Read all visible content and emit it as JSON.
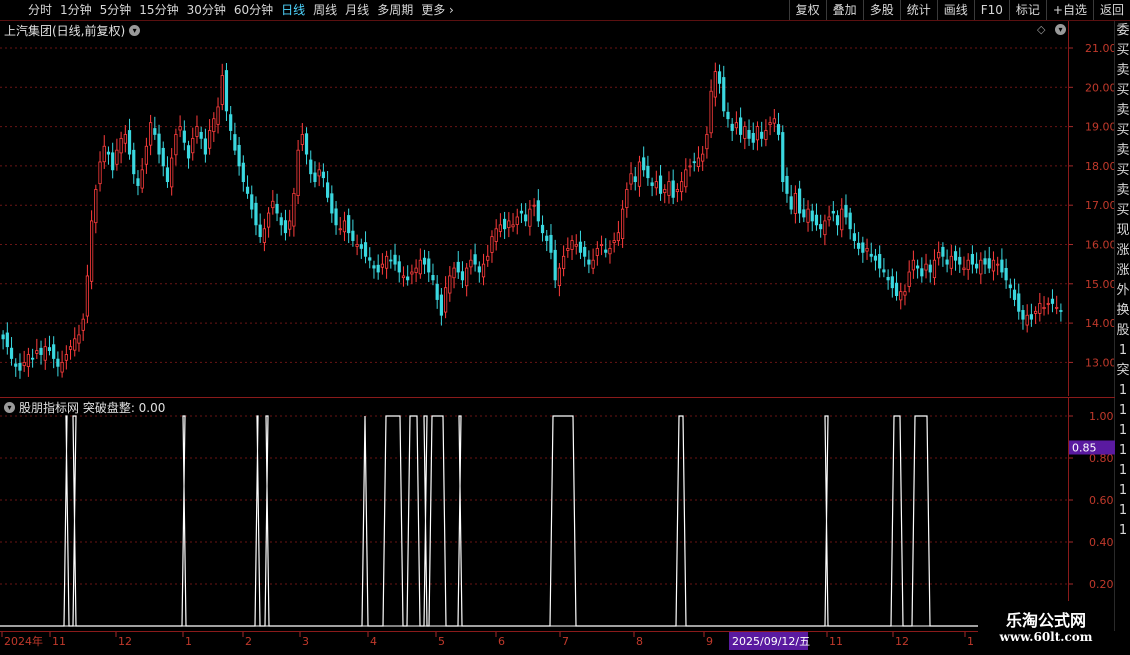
{
  "toolbar": {
    "periods": [
      "分时",
      "1分钟",
      "5分钟",
      "15分钟",
      "30分钟",
      "60分钟",
      "日线",
      "周线",
      "月线",
      "多周期",
      "更多 ›"
    ],
    "active": "日线",
    "right_buttons": [
      "复权",
      "叠加",
      "多股",
      "统计",
      "画线",
      "F10",
      "标记",
      "+自选",
      "返回"
    ]
  },
  "main_title": "上汽集团(日线,前复权)",
  "sub_title": "股朋指标网 突破盘整: 0.00",
  "side_strip_chars": [
    "委",
    "买",
    "卖",
    "买",
    "卖",
    "买",
    "卖",
    "买",
    "卖",
    "买",
    "现",
    "涨",
    "涨",
    "外",
    "换",
    "股",
    "1",
    "突",
    "1",
    "1",
    "1",
    "1",
    "1",
    "1",
    "1",
    "1"
  ],
  "price_axis": {
    "labels": [
      "21.00",
      "20.00",
      "19.00",
      "18.00",
      "17.00",
      "16.00",
      "15.00",
      "14.00",
      "13.00"
    ]
  },
  "sub_axis": {
    "labels": [
      "1.00",
      "0.80",
      "0.60",
      "0.40",
      "0.20"
    ],
    "highlight": "0.85"
  },
  "date_axis": {
    "labels": [
      "2024年",
      "11",
      "12",
      "1",
      "2",
      "3",
      "4",
      "5",
      "6",
      "7",
      "8",
      "9",
      "11",
      "12",
      "1"
    ],
    "cursor_label": "2025/09/12/五"
  },
  "watermark": {
    "line1": "乐淘公式网",
    "line2": "www.60lt.com"
  },
  "colors": {
    "up": "#ff3d3d",
    "down": "#3bd8e0",
    "line": "#ffffff",
    "grid": "#6a1515",
    "accent_cursor": "#5a1aa0"
  },
  "chart_data": {
    "type": "candlestick",
    "ylim": [
      12.5,
      21.3
    ],
    "closes": [
      13.6,
      13.4,
      13.1,
      12.9,
      12.8,
      13.0,
      13.2,
      13.1,
      13.3,
      13.2,
      13.4,
      13.3,
      13.1,
      12.9,
      13.0,
      13.2,
      13.4,
      13.6,
      13.7,
      14.1,
      15.2,
      16.6,
      17.4,
      18.1,
      18.5,
      18.3,
      17.9,
      18.4,
      18.7,
      18.8,
      18.3,
      17.8,
      17.5,
      17.9,
      18.5,
      19.1,
      18.8,
      18.3,
      18.0,
      17.6,
      18.2,
      18.8,
      19.0,
      18.6,
      18.2,
      18.7,
      19.0,
      18.7,
      18.3,
      18.9,
      19.2,
      19.5,
      20.3,
      19.4,
      18.9,
      18.4,
      18.0,
      17.6,
      17.3,
      16.9,
      16.5,
      16.2,
      16.4,
      16.8,
      17.1,
      16.8,
      16.5,
      16.3,
      16.6,
      17.3,
      18.4,
      18.8,
      18.3,
      17.8,
      17.6,
      17.9,
      17.7,
      17.2,
      16.8,
      16.5,
      16.4,
      16.6,
      16.3,
      16.1,
      16.0,
      15.9,
      15.7,
      15.6,
      15.4,
      15.3,
      15.5,
      15.7,
      15.6,
      15.5,
      15.3,
      15.2,
      15.1,
      15.3,
      15.4,
      15.6,
      15.5,
      15.3,
      15.1,
      14.6,
      14.2,
      14.9,
      15.2,
      15.4,
      15.3,
      15.1,
      15.4,
      15.6,
      15.5,
      15.3,
      15.5,
      15.7,
      16.2,
      16.4,
      16.5,
      16.4,
      16.6,
      16.5,
      16.7,
      16.8,
      16.6,
      16.9,
      17.0,
      16.6,
      16.3,
      16.1,
      15.8,
      15.1,
      15.4,
      15.7,
      15.9,
      16.1,
      16.0,
      15.8,
      15.7,
      15.5,
      15.6,
      15.9,
      16.0,
      15.8,
      15.9,
      16.1,
      16.3,
      16.9,
      17.4,
      17.8,
      17.6,
      18.1,
      17.9,
      17.7,
      17.5,
      17.6,
      17.3,
      17.4,
      17.6,
      17.2,
      17.4,
      17.6,
      17.9,
      18.0,
      18.1,
      18.2,
      18.3,
      18.8,
      19.9,
      20.4,
      20.1,
      19.4,
      19.2,
      18.9,
      19.1,
      18.8,
      19.0,
      18.7,
      18.6,
      19.0,
      18.7,
      18.9,
      19.1,
      19.2,
      18.8,
      17.6,
      17.3,
      16.9,
      17.3,
      16.8,
      16.7,
      16.9,
      16.6,
      16.5,
      16.4,
      16.6,
      16.7,
      16.8,
      16.5,
      16.9,
      16.7,
      16.4,
      16.1,
      15.9,
      15.8,
      15.9,
      15.7,
      15.6,
      15.4,
      15.3,
      15.1,
      14.9,
      14.7,
      14.8,
      14.8,
      15.3,
      15.6,
      15.4,
      15.2,
      15.5,
      15.3,
      15.6,
      15.8,
      15.7,
      15.5,
      15.7,
      15.6,
      15.5,
      15.4,
      15.6,
      15.5,
      15.4,
      15.6,
      15.5,
      15.4,
      15.6,
      15.5,
      15.3,
      15.1,
      14.9,
      14.6,
      14.3,
      14.1,
      14.2,
      14.1,
      14.3,
      14.5,
      14.4,
      14.5,
      14.5,
      14.4,
      14.3
    ],
    "indicator": {
      "name": "突破盘整",
      "value": 0.0,
      "ylim": [
        0,
        1.1
      ],
      "active_ranges": [
        [
          64,
          69
        ],
        [
          73,
          76
        ],
        [
          182,
          186
        ],
        [
          255,
          260
        ],
        [
          265,
          269
        ],
        [
          362,
          368
        ],
        [
          383,
          403
        ],
        [
          407,
          420
        ],
        [
          424,
          427
        ],
        [
          429,
          446
        ],
        [
          458,
          462
        ],
        [
          550,
          576
        ],
        [
          676,
          686
        ],
        [
          825,
          828
        ],
        [
          891,
          903
        ],
        [
          912,
          930
        ]
      ]
    }
  }
}
